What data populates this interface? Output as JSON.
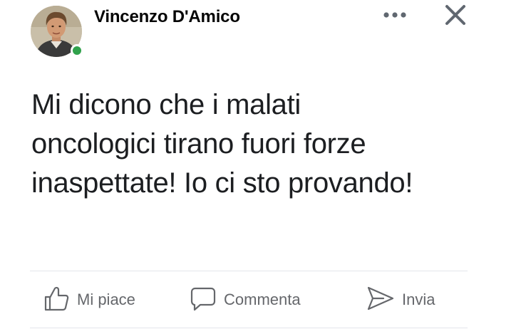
{
  "post": {
    "author_name": "Vincenzo D'Amico",
    "author_online": true,
    "text_lines": [
      "Mi dicono che i malati",
      "oncologici tirano fuori forze",
      "inaspettate! Io ci sto provando!"
    ]
  },
  "header": {
    "more_icon": "more-horizontal-icon",
    "close_icon": "close-icon"
  },
  "actions": [
    {
      "label": "Mi piace",
      "icon": "thumbs-up-icon"
    },
    {
      "label": "Commenta",
      "icon": "comment-icon"
    },
    {
      "label": "Invia",
      "icon": "send-icon"
    }
  ],
  "colors": {
    "online": "#31a24c",
    "action_text": "#65676b",
    "divider": "#e4e6eb"
  }
}
